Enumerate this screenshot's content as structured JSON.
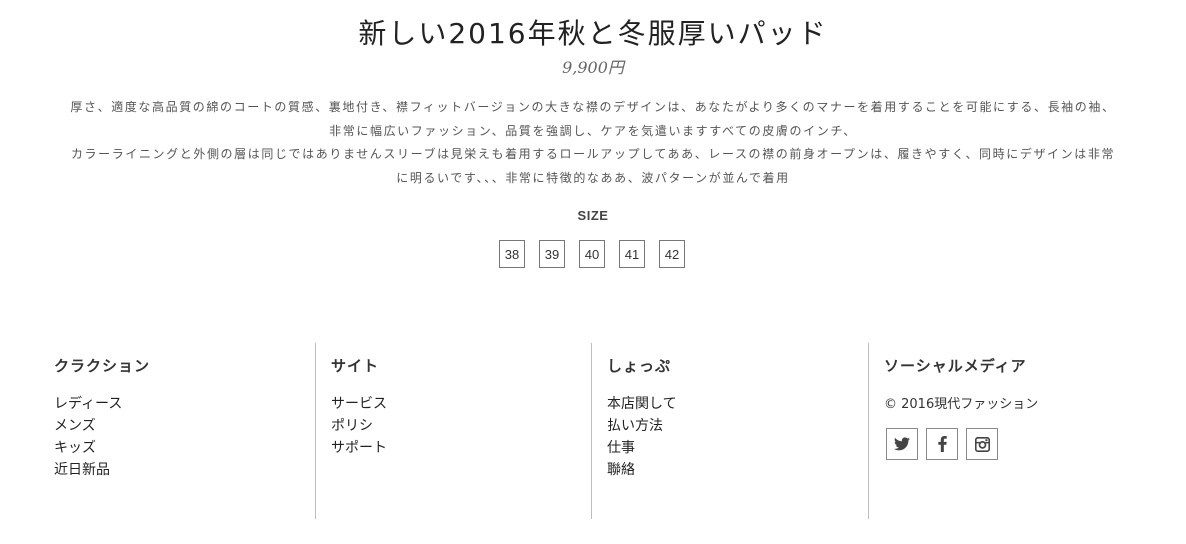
{
  "product": {
    "title": "新しい2016年秋と冬服厚いパッド",
    "price": "9,900円",
    "description": [
      "厚さ、適度な高品質の綿のコートの質感、裏地付き、襟フィットバージョンの大きな襟のデザインは、あなたがより多くのマナーを着用することを可能にする、長袖の袖、",
      "非常に幅広いファッション、品質を強調し、ケアを気遣いますすべての皮膚のインチ、",
      "カラーライニングと外側の層は同じではありませんスリーブは見栄えも着用するロールアップしてああ、レースの襟の前身オープンは、履きやすく、同時にデザインは非常",
      "に明るいです、、、非常に特徴的なああ、波パターンが並んで着用"
    ],
    "size_label": "SIZE",
    "sizes": [
      "38",
      "39",
      "40",
      "41",
      "42"
    ]
  },
  "footer": {
    "collection": {
      "title": "クラクション",
      "links": [
        "レディース",
        "メンズ",
        "キッズ",
        "近日新品"
      ]
    },
    "site": {
      "title": "サイト",
      "links": [
        "サービス",
        "ポリシ",
        "サポート"
      ]
    },
    "shop": {
      "title": "しょっぷ",
      "links": [
        "本店関して",
        "払い方法",
        "仕事",
        "聯絡"
      ]
    },
    "social": {
      "title": "ソーシャルメディア",
      "copyright": "© 2016現代ファッション",
      "icons": [
        "twitter-icon",
        "facebook-icon",
        "instagram-icon"
      ]
    }
  }
}
